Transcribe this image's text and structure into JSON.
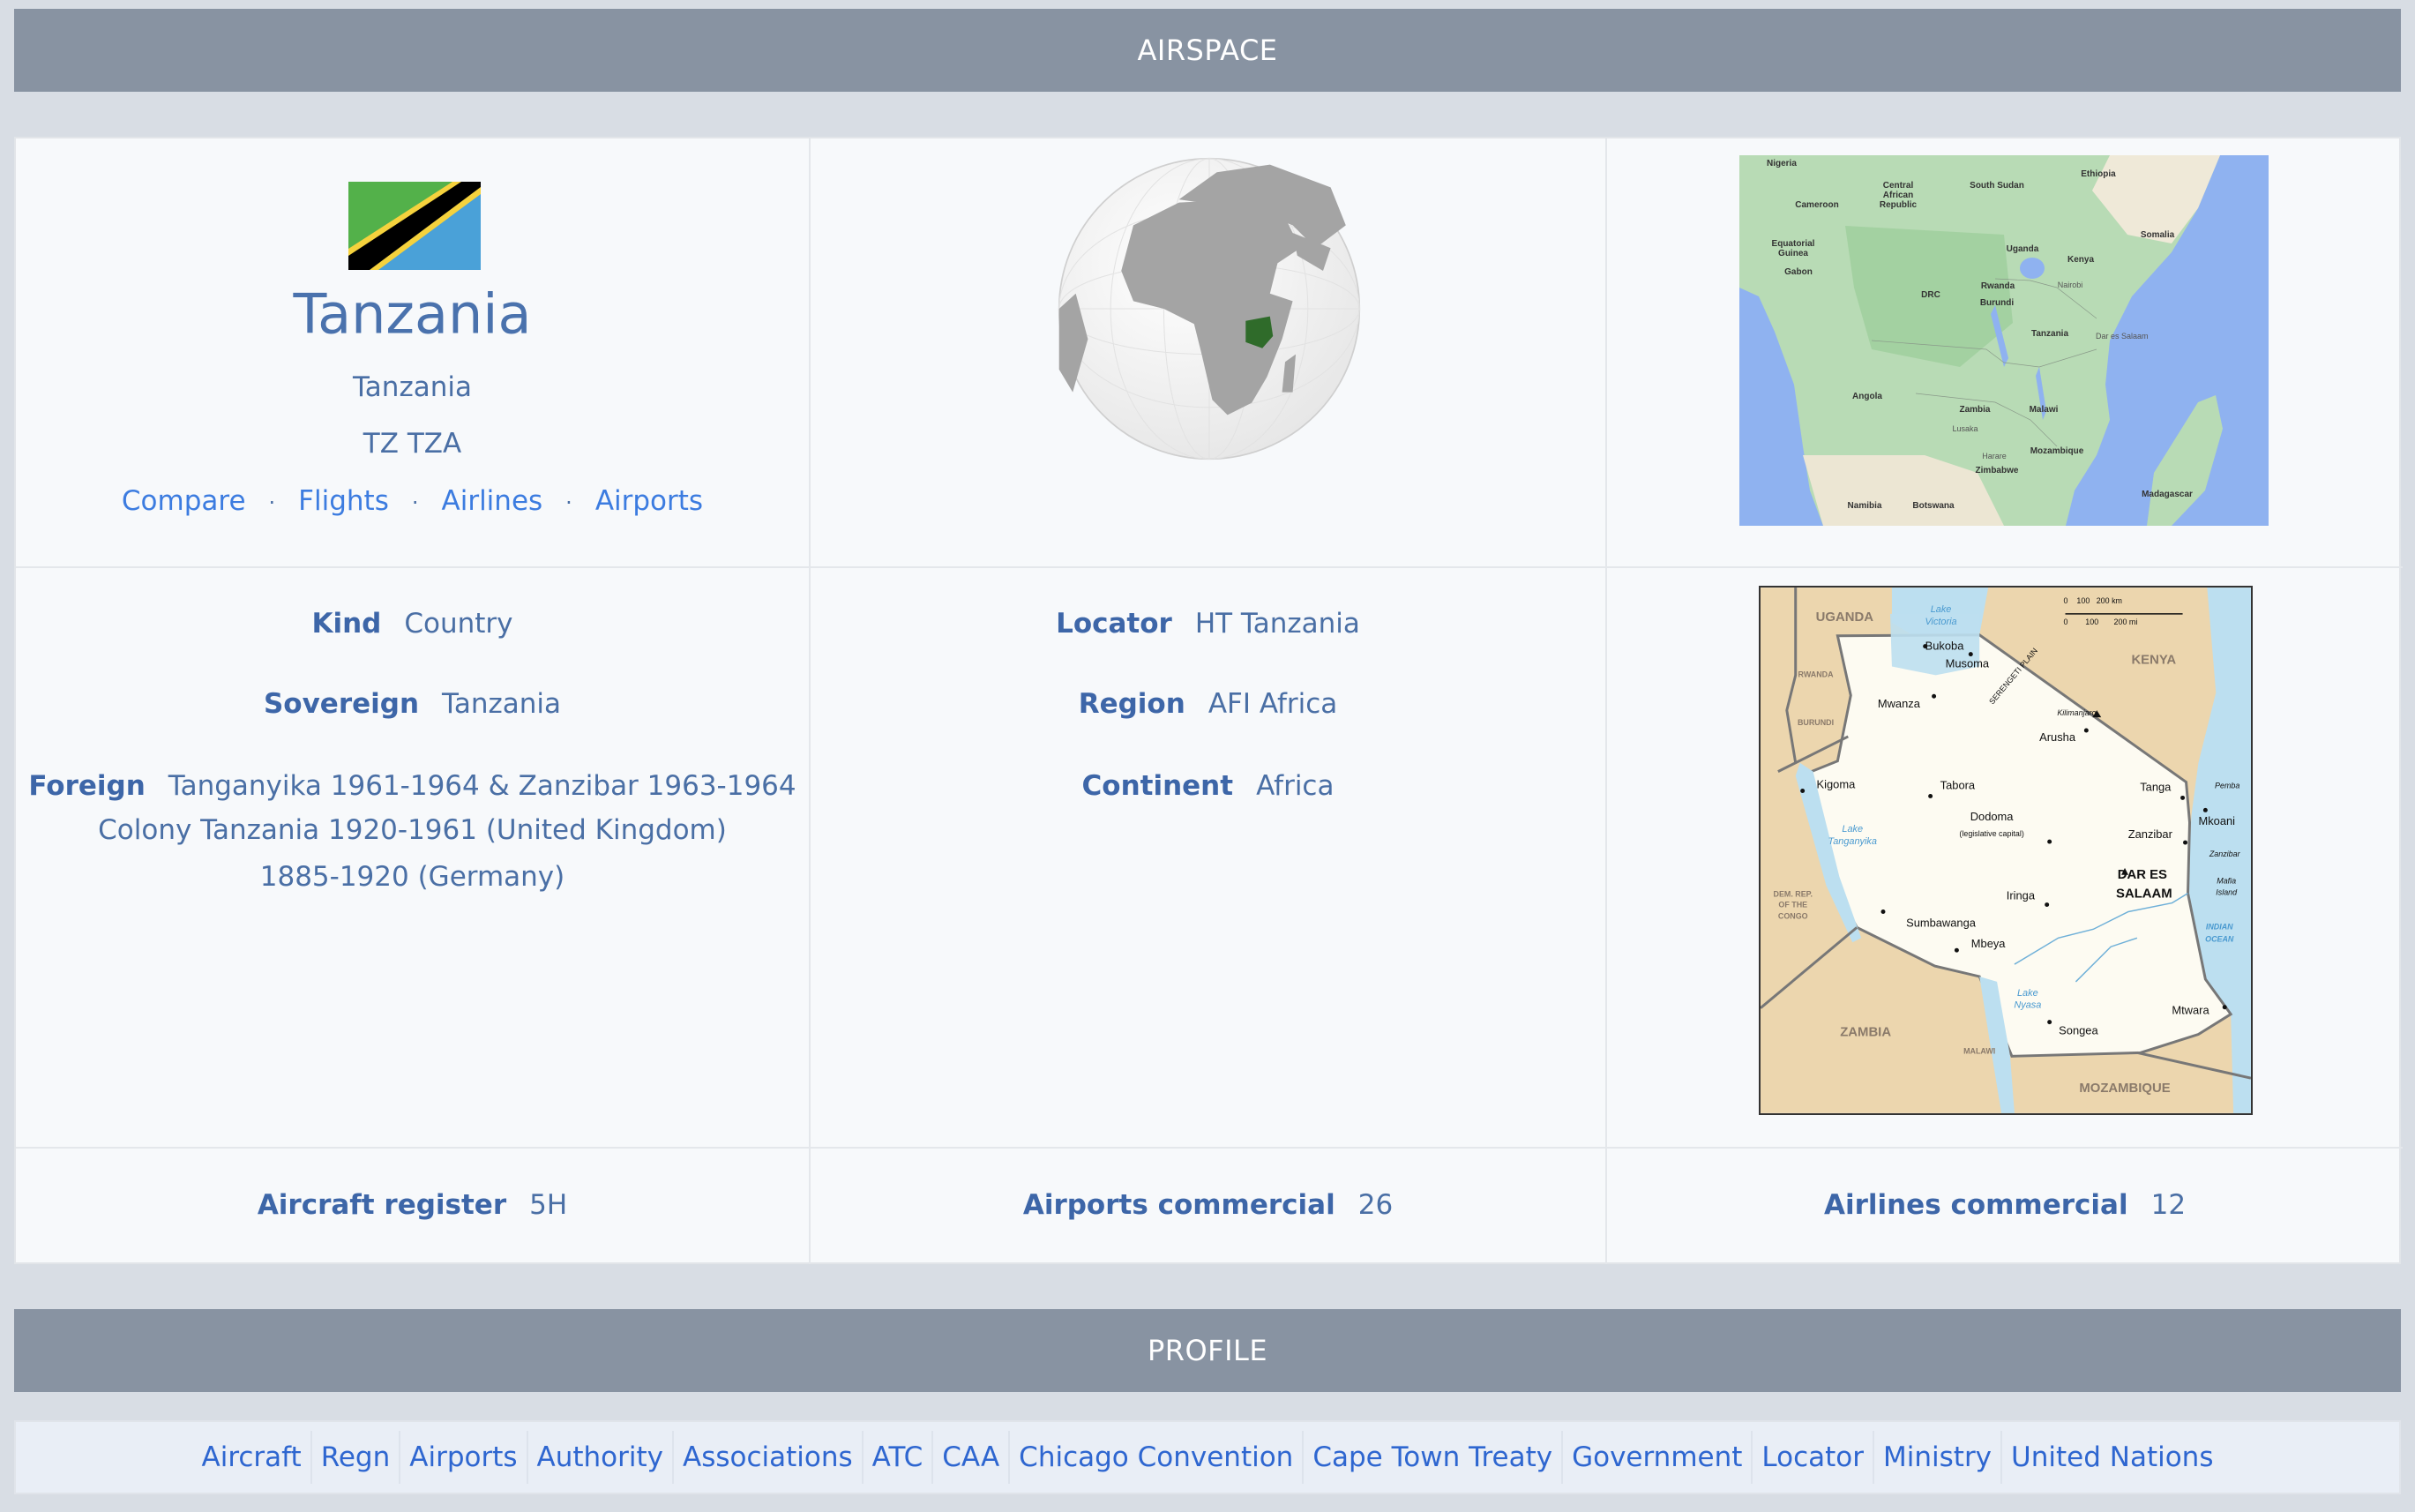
{
  "airspace_header": "AIRSPACE",
  "profile_header": "PROFILE",
  "country": {
    "flag_icon": "tanzania-flag",
    "name": "Tanzania",
    "official_name": "Tanzania",
    "codes": "TZ TZA",
    "links": [
      "Compare",
      "Flights",
      "Airlines",
      "Airports"
    ],
    "separator": "·"
  },
  "details_left": {
    "kind_label": "Kind",
    "kind_value": "Country",
    "sovereign_label": "Sovereign",
    "sovereign_value": "Tanzania",
    "foreign_label": "Foreign",
    "foreign_lines": [
      "Tanganyika 1961-1964 & Zanzibar 1963-1964",
      "Colony Tanzania 1920-1961 (United Kingdom)",
      "1885-1920 (Germany)"
    ]
  },
  "details_mid": {
    "locator_label": "Locator",
    "locator_value": "HT Tanzania",
    "region_label": "Region",
    "region_value": "AFI Africa",
    "continent_label": "Continent",
    "continent_value": "Africa"
  },
  "stats": {
    "aircraft_register_label": "Aircraft register",
    "aircraft_register_value": "5H",
    "airports_commercial_label": "Airports commercial",
    "airports_commercial_value": "26",
    "airlines_commercial_label": "Airlines commercial",
    "airlines_commercial_value": "12"
  },
  "region_map_labels": {
    "nigeria": "Nigeria",
    "car1": "Central",
    "car2": "African",
    "car3": "Republic",
    "south_sudan": "South Sudan",
    "ethiopia": "Ethiopia",
    "cameroon": "Cameroon",
    "eqg1": "Equatorial",
    "eqg2": "Guinea",
    "gabon": "Gabon",
    "somalia": "Somalia",
    "uganda": "Uganda",
    "kenya": "Kenya",
    "nairobi": "Nairobi",
    "rwanda": "Rwanda",
    "burundi": "Burundi",
    "drc": "DRC",
    "tanzania": "Tanzania",
    "dar": "Dar es Salaam",
    "angola": "Angola",
    "zambia": "Zambia",
    "malawi": "Malawi",
    "lusaka": "Lusaka",
    "mozambique": "Mozambique",
    "harare": "Harare",
    "zimbabwe": "Zimbabwe",
    "namibia": "Namibia",
    "botswana": "Botswana",
    "madagascar": "Madagascar"
  },
  "country_map_labels": {
    "uganda": "UGANDA",
    "lake_victoria_1": "Lake",
    "lake_victoria_2": "Victoria",
    "bukoba": "Bukoba",
    "musoma": "Musoma",
    "kenya": "KENYA",
    "rwanda": "RWANDA",
    "mwanza": "Mwanza",
    "serengeti": "SERENGETI PLAIN",
    "kilimanjaro": "Kilimanjaro",
    "arusha": "Arusha",
    "burundi": "BURUNDI",
    "kigoma": "Kigoma",
    "tabora": "Tabora",
    "tanga": "Tanga",
    "pemba": "Pemba",
    "dodoma": "Dodoma",
    "dodoma_note": "(legislative capital)",
    "mkoani": "Mkoani",
    "zanzibar": "Zanzibar",
    "zanzibar_island": "Zanzibar",
    "lake_tanganyika_1": "Lake",
    "lake_tanganyika_2": "Tanganyika",
    "dar_1": "DAR ES",
    "dar_2": "SALAAM",
    "mafia_1": "Mafia",
    "mafia_2": "Island",
    "iringa": "Iringa",
    "drc_1": "DEM. REP.",
    "drc_2": "OF THE",
    "drc_3": "CONGO",
    "sumbawanga": "Sumbawanga",
    "ocean_1": "INDIAN",
    "ocean_2": "OCEAN",
    "mbeya": "Mbeya",
    "lake_nyasa_1": "Lake",
    "lake_nyasa_2": "Nyasa",
    "mtwara": "Mtwara",
    "songea": "Songea",
    "zambia": "ZAMBIA",
    "malawi": "MALAWI",
    "mozambique": "MOZAMBIQUE",
    "scale_km": "0    100   200 km",
    "scale_mi": "0        100       200 mi"
  },
  "profile_nav": [
    "Aircraft",
    "Regn",
    "Airports",
    "Authority",
    "Associations",
    "ATC",
    "CAA",
    "Chicago Convention",
    "Cape Town Treaty",
    "Government",
    "Locator",
    "Ministry",
    "United Nations"
  ],
  "colors": {
    "header": "#8893a2",
    "background": "#d8dde4",
    "link": "#3c7ce0",
    "label": "#3d66a8",
    "flag_green": "#53b14a",
    "flag_blue": "#4aa1d8",
    "flag_yellow": "#f5d23d"
  }
}
